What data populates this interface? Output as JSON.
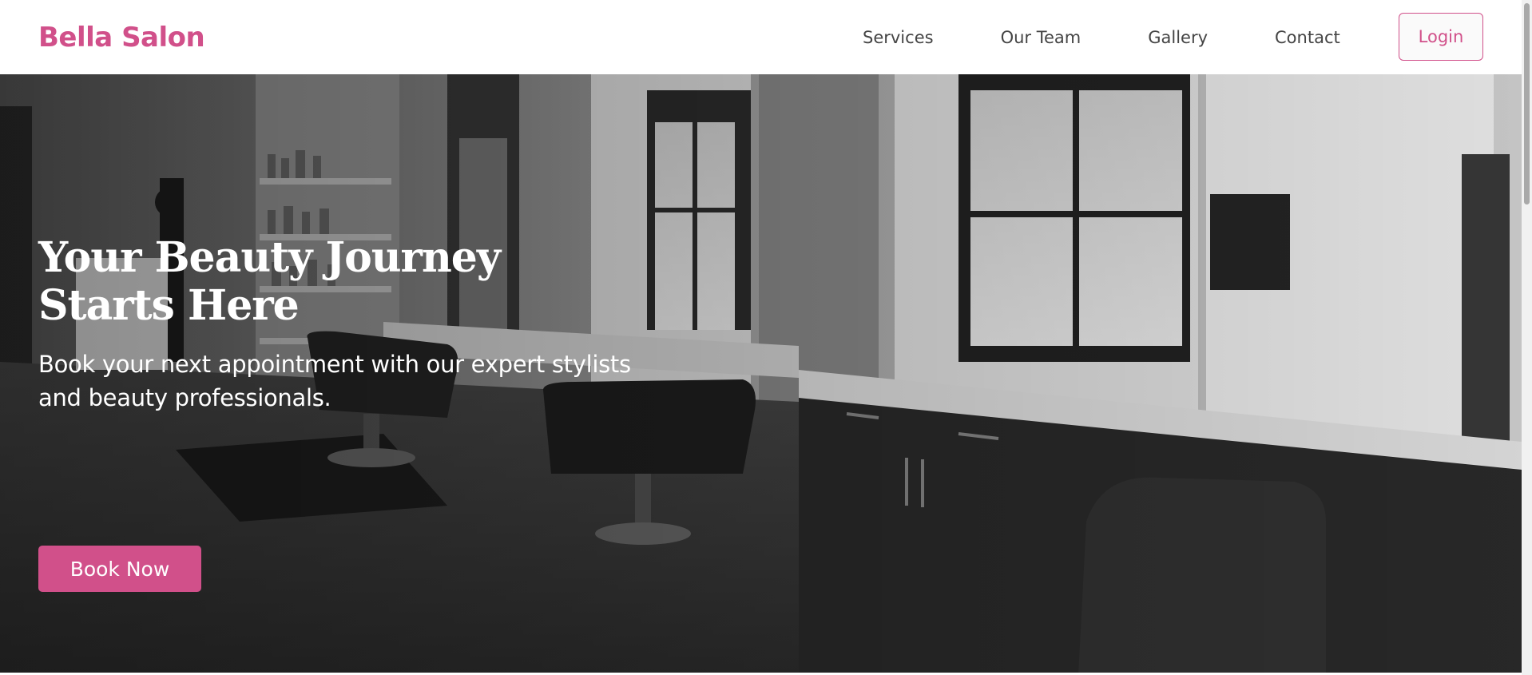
{
  "brand": {
    "name": "Bella Salon",
    "accent_color": "#d1508a"
  },
  "nav": {
    "items": [
      {
        "label": "Services"
      },
      {
        "label": "Our Team"
      },
      {
        "label": "Gallery"
      },
      {
        "label": "Contact"
      }
    ],
    "login_label": "Login"
  },
  "hero": {
    "title": "Your Beauty Journey Starts Here",
    "subtitle": "Book your next appointment with our expert stylists and beauty professionals.",
    "cta_label": "Book Now",
    "background": "salon-interior-grayscale-photo"
  }
}
